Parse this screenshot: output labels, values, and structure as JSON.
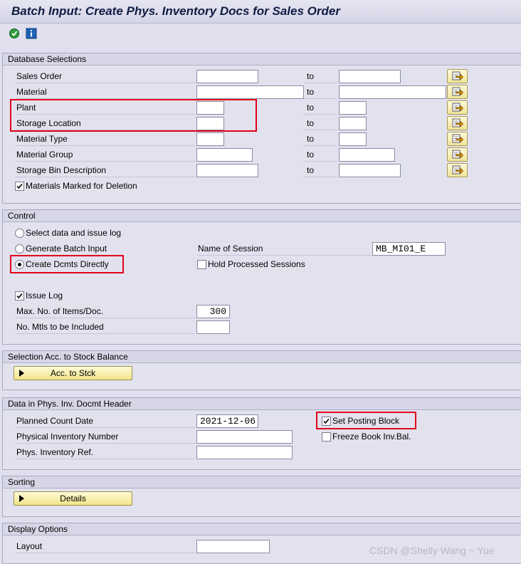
{
  "window": {
    "title": "Batch Input: Create Phys. Inventory Docs for Sales Order"
  },
  "toolbar": {
    "execute_icon": "execute-icon",
    "info_icon": "info-icon"
  },
  "database_selections": {
    "title": "Database Selections",
    "to_label": "to",
    "fields": [
      {
        "label": "Sales Order",
        "from": "",
        "to": ""
      },
      {
        "label": "Material",
        "from": "",
        "to": ""
      },
      {
        "label": "Plant",
        "from": "",
        "to": ""
      },
      {
        "label": "Storage Location",
        "from": "",
        "to": ""
      },
      {
        "label": "Material Type",
        "from": "",
        "to": ""
      },
      {
        "label": "Material Group",
        "from": "",
        "to": ""
      },
      {
        "label": "Storage Bin Description",
        "from": "",
        "to": ""
      }
    ],
    "deletion_checkbox": {
      "label": "Materials Marked for Deletion",
      "checked": true
    }
  },
  "control": {
    "title": "Control",
    "radios": [
      {
        "label": "Select data and issue log",
        "selected": false
      },
      {
        "label": "Generate Batch Input",
        "selected": false
      },
      {
        "label": "Create Dcmts Directly",
        "selected": true
      }
    ],
    "session_name_label": "Name of Session",
    "session_name_value": "MB_MI01_E",
    "hold_sessions": {
      "label": "Hold Processed Sessions",
      "checked": false
    },
    "issue_log": {
      "label": "Issue Log",
      "checked": true
    },
    "max_items_label": "Max. No. of Items/Doc.",
    "max_items_value": "300",
    "no_mtls_label": "No. Mtls to be Included",
    "no_mtls_value": ""
  },
  "stock_balance": {
    "title": "Selection Acc. to Stock Balance",
    "button_label": "Acc. to Stck"
  },
  "header_data": {
    "title": "Data in Phys. Inv. Docmt Header",
    "planned_count_date_label": "Planned Count Date",
    "planned_count_date_value": "2021-12-06",
    "phys_inv_number_label": "Physical Inventory Number",
    "phys_inv_number_value": "",
    "phys_inv_ref_label": "Phys. Inventory Ref.",
    "phys_inv_ref_value": "",
    "set_posting_block": {
      "label": "Set Posting Block",
      "checked": true
    },
    "freeze_book": {
      "label": "Freeze Book Inv.Bal.",
      "checked": false
    }
  },
  "sorting": {
    "title": "Sorting",
    "button_label": "Details"
  },
  "display_options": {
    "title": "Display Options",
    "layout_label": "Layout",
    "layout_value": ""
  },
  "watermark": "CSDN @Shelly Wang ~ Yue",
  "colors": {
    "background": "#dfdfee",
    "title_text": "#0f1c44",
    "button_yellow": "#f3e48a",
    "highlight_red": "#e0001a"
  }
}
